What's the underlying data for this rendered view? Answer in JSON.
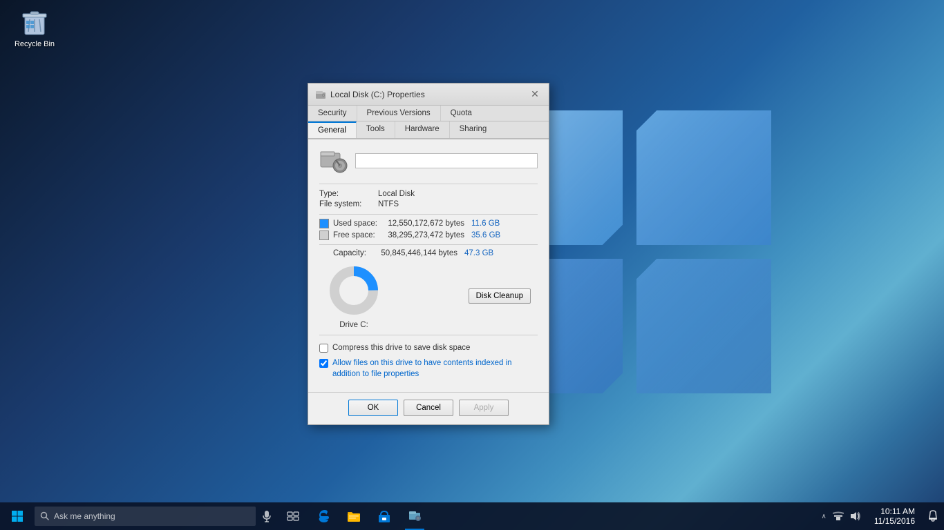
{
  "desktop": {
    "recycle_bin_label": "Recycle Bin"
  },
  "dialog": {
    "title": "Local Disk (C:) Properties",
    "tabs_row1": [
      {
        "id": "security",
        "label": "Security",
        "active": false
      },
      {
        "id": "previous-versions",
        "label": "Previous Versions",
        "active": false
      },
      {
        "id": "quota",
        "label": "Quota",
        "active": false
      }
    ],
    "tabs_row2": [
      {
        "id": "general",
        "label": "General",
        "active": true
      },
      {
        "id": "tools",
        "label": "Tools",
        "active": false
      },
      {
        "id": "hardware",
        "label": "Hardware",
        "active": false
      },
      {
        "id": "sharing",
        "label": "Sharing",
        "active": false
      }
    ],
    "drive_label_value": "",
    "type_label": "Type:",
    "type_value": "Local Disk",
    "filesystem_label": "File system:",
    "filesystem_value": "NTFS",
    "used_space_label": "Used space:",
    "used_space_bytes": "12,550,172,672 bytes",
    "used_space_gb": "11.6 GB",
    "free_space_label": "Free space:",
    "free_space_bytes": "38,295,273,472 bytes",
    "free_space_gb": "35.6 GB",
    "capacity_label": "Capacity:",
    "capacity_bytes": "50,845,446,144 bytes",
    "capacity_gb": "47.3 GB",
    "drive_letter_label": "Drive C:",
    "disk_cleanup_btn": "Disk Cleanup",
    "compress_label": "Compress this drive to save disk space",
    "index_label": "Allow files on this drive to have contents indexed in addition to file properties",
    "ok_btn": "OK",
    "cancel_btn": "Cancel",
    "apply_btn": "Apply",
    "donut": {
      "used_pct": 24.7,
      "free_pct": 75.3,
      "used_color": "#1e90ff",
      "free_color": "#d0d0d0"
    }
  },
  "taskbar": {
    "search_placeholder": "Ask me anything",
    "clock_time": "10:11 AM",
    "clock_date": "11/15/2016",
    "mic_icon": "🎤",
    "start_icon": "⊞"
  }
}
